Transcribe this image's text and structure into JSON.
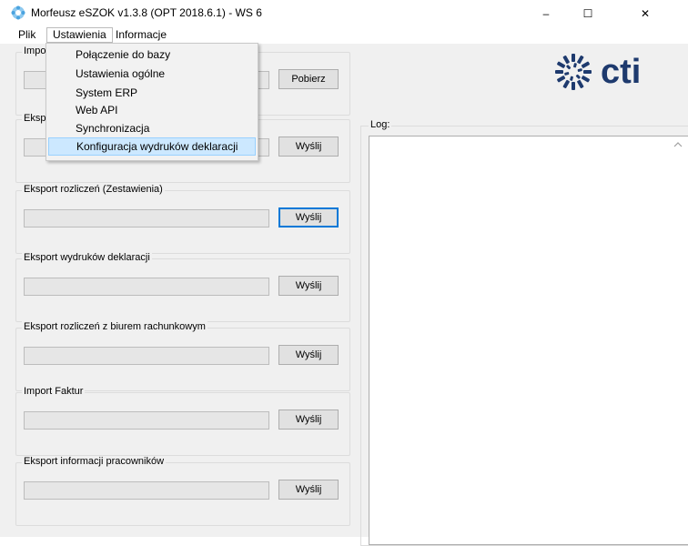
{
  "window": {
    "title": "Morfeusz eSZOK v1.3.8 (OPT 2018.6.1) - WS 6",
    "minimize_glyph": "–",
    "maximize_glyph": "☐",
    "close_glyph": "✕",
    "icon": "gear-flower-icon"
  },
  "menubar": {
    "items": [
      "Plik",
      "Ustawienia",
      "Informacje"
    ],
    "open_menu": "Ustawienia"
  },
  "dropdown": {
    "items": [
      "Połączenie do bazy",
      "Ustawienia ogólne",
      "System ERP",
      "Web API",
      "Synchronizacja",
      "Konfiguracja wydruków deklaracji"
    ],
    "highlighted": "Konfiguracja wydruków deklaracji"
  },
  "groups": [
    {
      "title": "Impo",
      "button": "Pobierz"
    },
    {
      "title": "Eksp",
      "button": "Wyślij"
    },
    {
      "title": "Eksport rozliczeń (Zestawienia)",
      "button": "Wyślij"
    },
    {
      "title": "Eksport wydruków deklaracji",
      "button": "Wyślij"
    },
    {
      "title": "Eksport rozliczeń z biurem rachunkowym",
      "button": "Wyślij"
    },
    {
      "title": "Import Faktur",
      "button": "Wyślij"
    },
    {
      "title": "Eksport informacji pracowników",
      "button": "Wyślij"
    }
  ],
  "log": {
    "label": "Log:"
  },
  "logo": {
    "text": "cti",
    "color": "#1e3a6e",
    "icon": "cti-logo-icon"
  },
  "colors": {
    "accent": "#0078d7",
    "highlight": "#cce8ff"
  }
}
